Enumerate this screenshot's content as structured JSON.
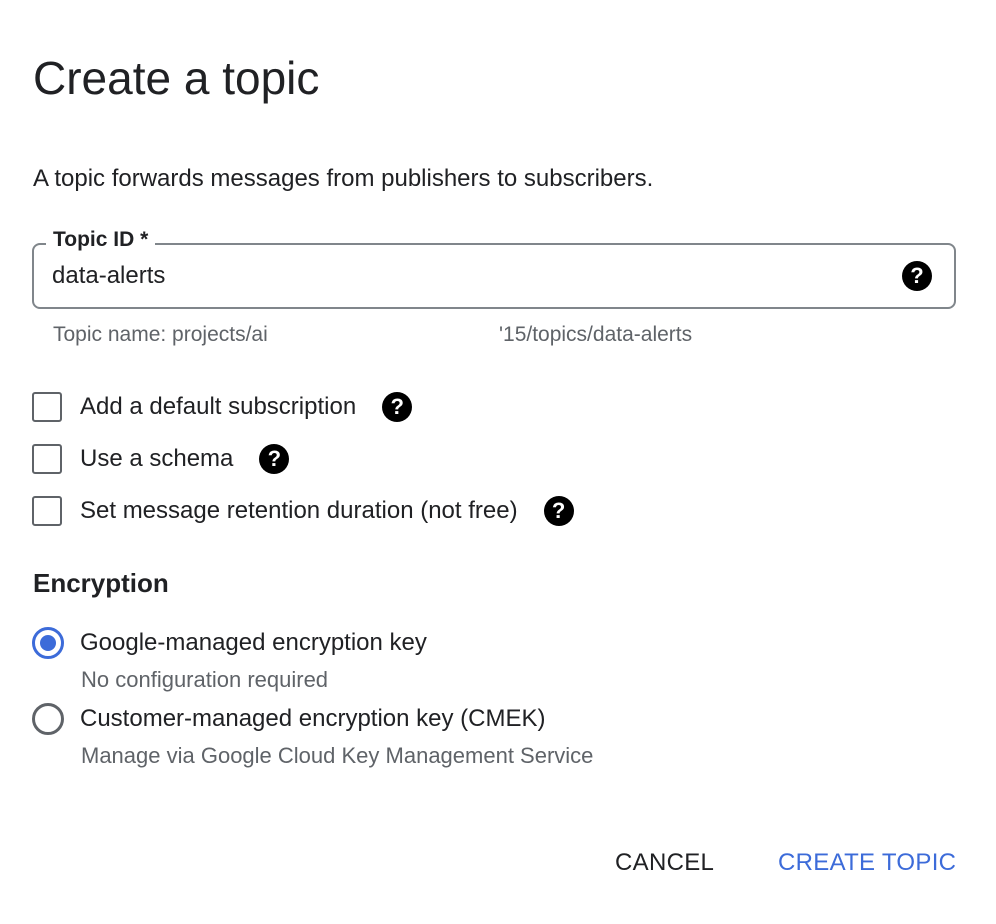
{
  "dialog": {
    "title": "Create a topic",
    "description": "A topic forwards messages from publishers to subscribers."
  },
  "topic_id": {
    "label": "Topic ID *",
    "value": "data-alerts",
    "help_icon": "help-circle-icon",
    "hint_prefix": "Topic name: projects/ai",
    "hint_suffix": "'15/topics/data-alerts"
  },
  "options": [
    {
      "label": "Add a default subscription",
      "checked": false,
      "help_icon": "help-circle-icon"
    },
    {
      "label": "Use a schema",
      "checked": false,
      "help_icon": "help-circle-icon"
    },
    {
      "label": "Set message retention duration (not free)",
      "checked": false,
      "help_icon": "help-circle-icon"
    }
  ],
  "encryption": {
    "title": "Encryption",
    "choices": [
      {
        "label": "Google-managed encryption key",
        "sublabel": "No configuration required",
        "selected": true
      },
      {
        "label": "Customer-managed encryption key (CMEK)",
        "sublabel": "Manage via Google Cloud Key Management Service",
        "selected": false
      }
    ]
  },
  "actions": {
    "cancel_label": "CANCEL",
    "create_label": "CREATE TOPIC"
  },
  "colors": {
    "accent": "#3c6bd9",
    "text": "#202124",
    "secondary_text": "#5f6368",
    "border": "#80868b"
  }
}
